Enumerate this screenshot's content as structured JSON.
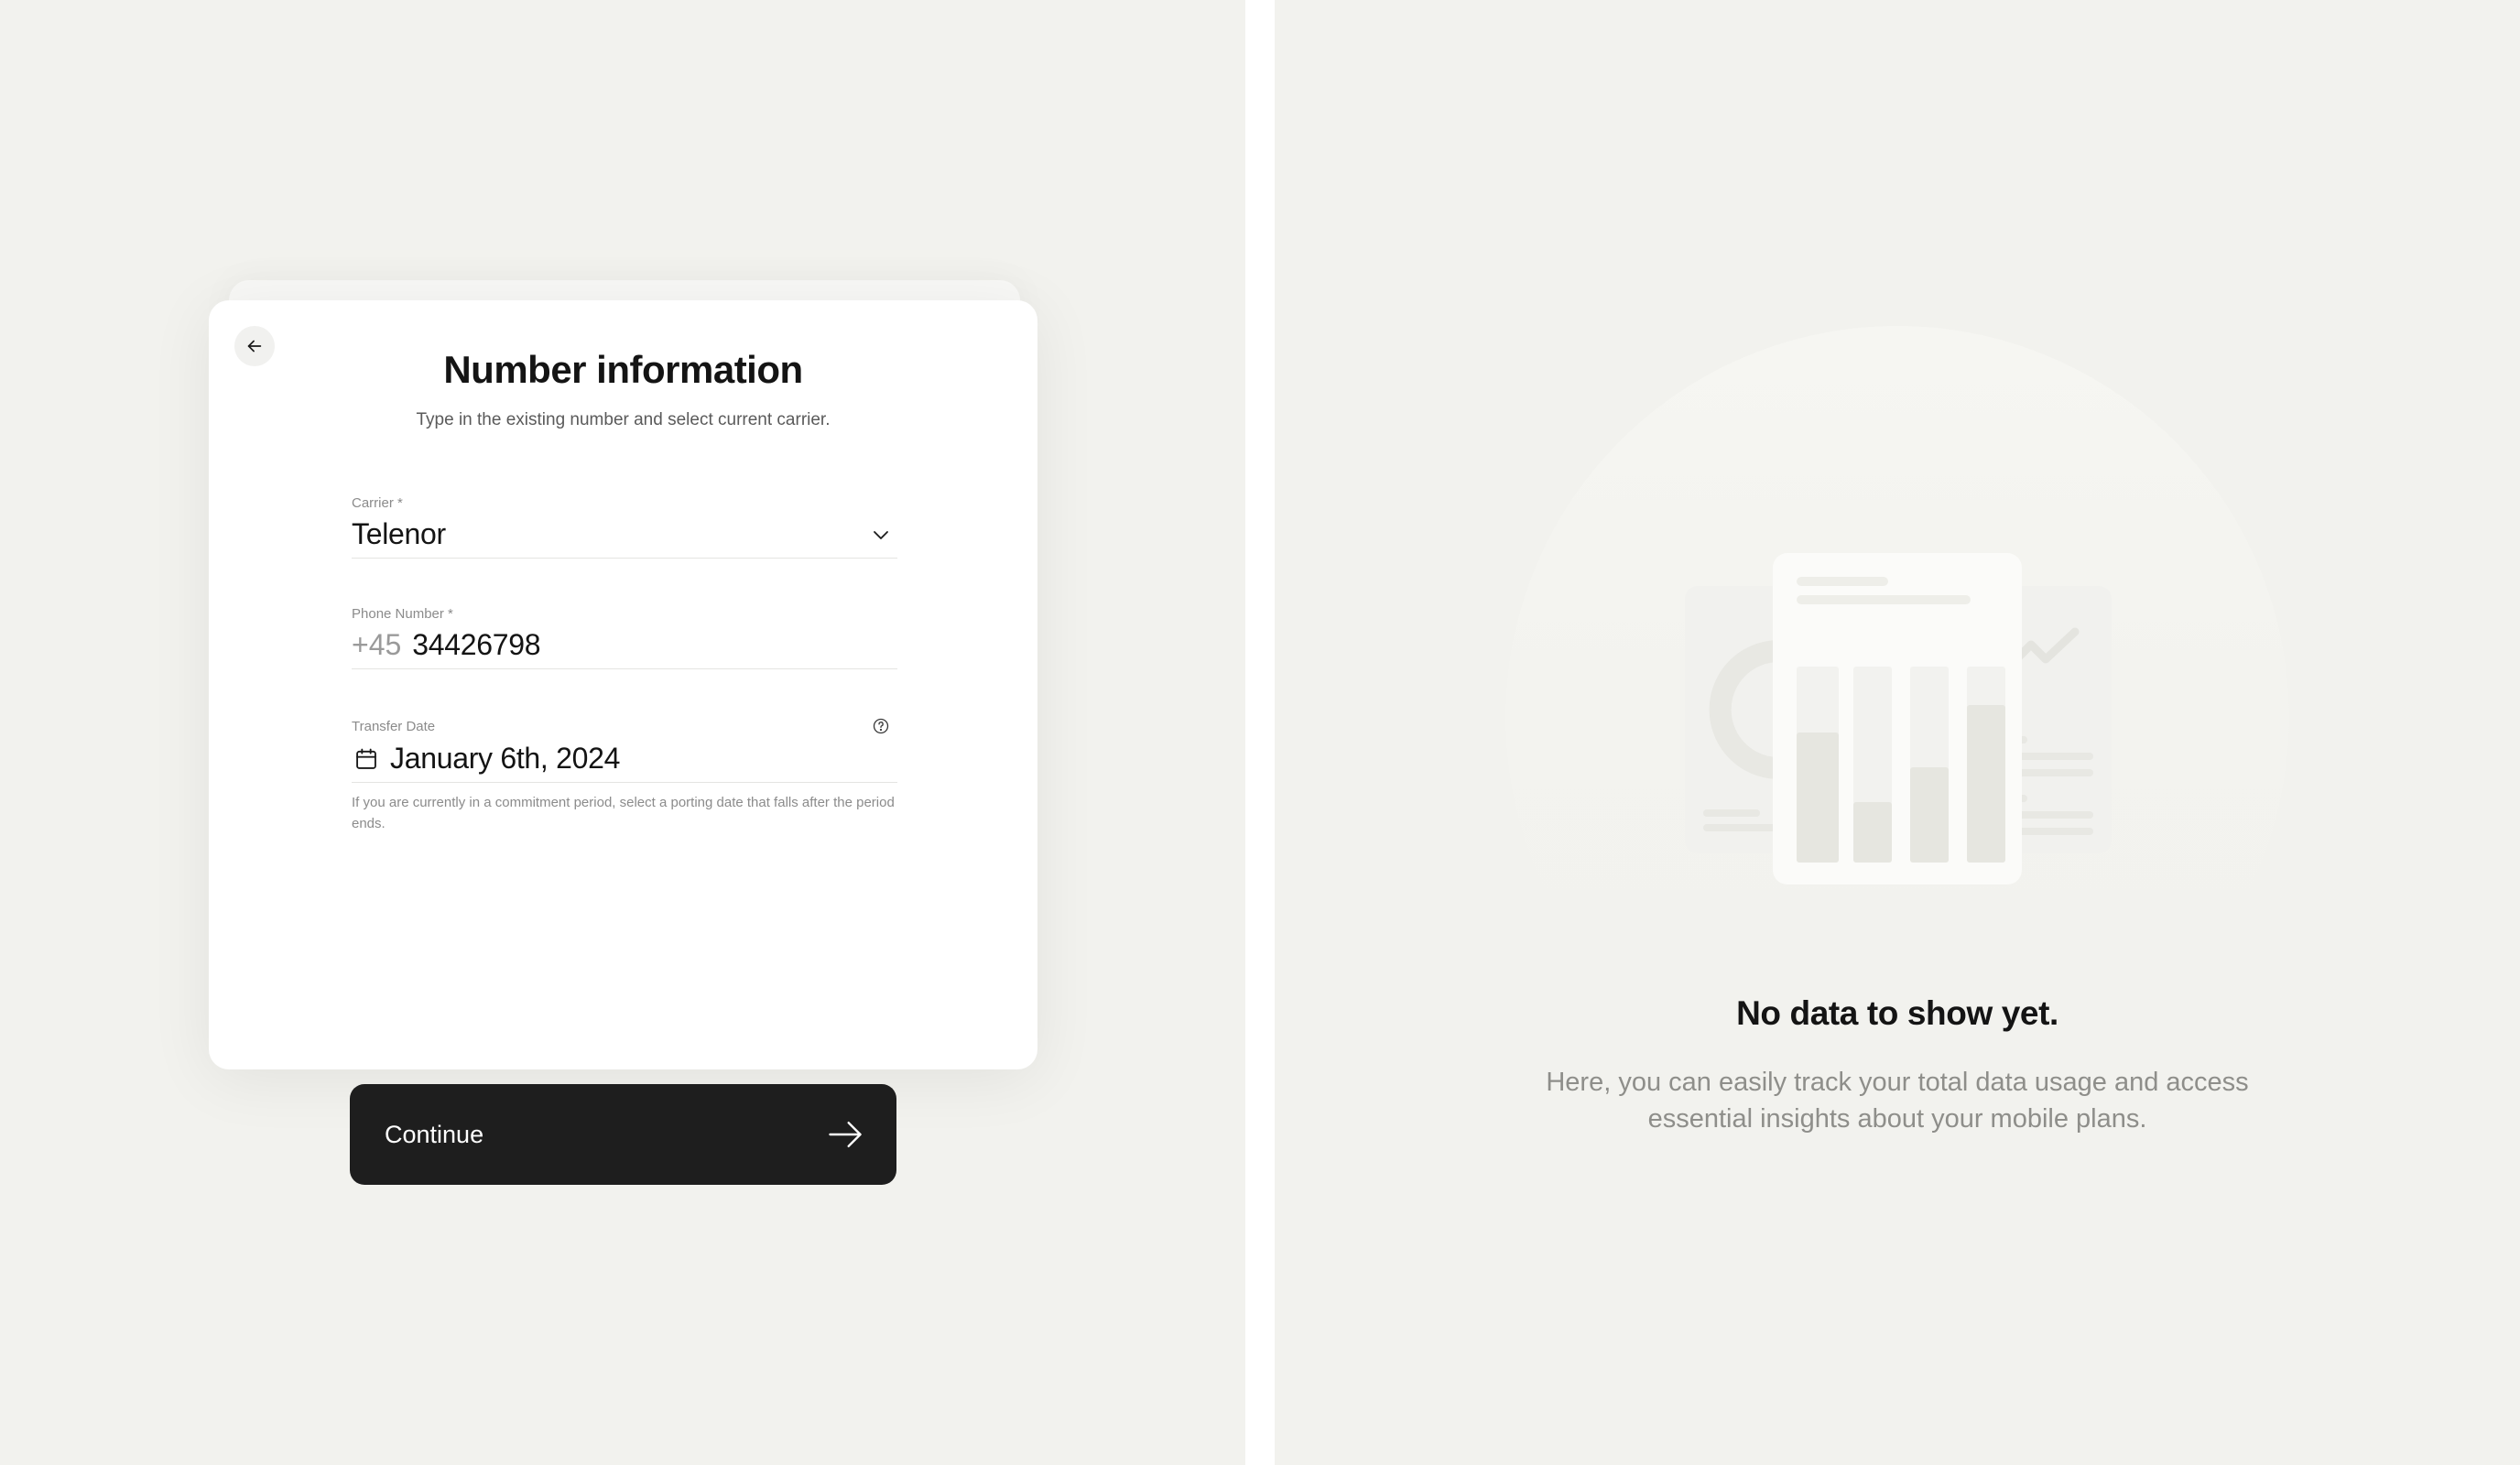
{
  "form": {
    "title": "Number information",
    "subtitle": "Type in the existing number and select current carrier.",
    "carrier": {
      "label": "Carrier *",
      "value": "Telenor"
    },
    "phone": {
      "label": "Phone Number *",
      "prefix": "+45",
      "value": "34426798"
    },
    "transfer_date": {
      "label": "Transfer Date",
      "value": "January 6th, 2024",
      "helper": "If you are currently in a commitment period, select a porting date that falls after the period ends."
    },
    "continue_label": "Continue"
  },
  "empty_state": {
    "title": "No data to show yet.",
    "description": "Here, you can easily track your total data usage and access essential insights about your mobile plans."
  },
  "icons": {
    "back": "arrow-left-icon",
    "dropdown": "chevron-down-icon",
    "calendar": "calendar-icon",
    "help": "question-circle-icon",
    "continue": "arrow-right-icon"
  },
  "colors": {
    "background": "#f2f2ee",
    "card": "#ffffff",
    "button": "#1e1e1e",
    "text_primary": "#141414",
    "text_muted": "#8b8b8b"
  }
}
